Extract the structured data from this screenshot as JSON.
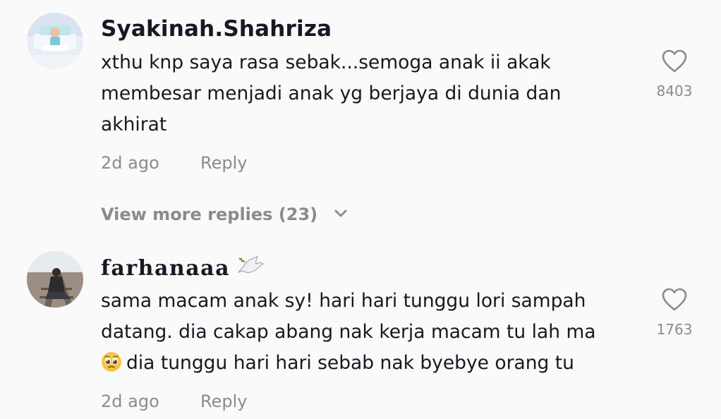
{
  "comments": [
    {
      "username": "Syakinah.Shahriza",
      "text_lines": [
        "xthu knp saya rasa sebak...semoga anak ii akak",
        "membesar menjadi anak yg berjaya di dunia dan",
        "akhirat"
      ],
      "time": "2d ago",
      "reply_label": "Reply",
      "likes": "8403",
      "view_more": "View more replies (23)"
    },
    {
      "username": "farhanaaa",
      "text_lines": [
        "sama macam anak sy! hari hari tunggu lori sampah",
        "datang. dia cakap abang nak kerja macam tu lah ma",
        "dia tunggu hari hari sebab nak byebye orang tu"
      ],
      "emoji": "pleading-face-emoji",
      "time": "2d ago",
      "reply_label": "Reply",
      "likes": "1763"
    }
  ],
  "icons": {
    "like": "heart-outline-icon",
    "expand": "chevron-down-icon",
    "username_decoration": "dove-icon"
  },
  "colors": {
    "background": "#fafafa",
    "text": "#161823",
    "secondary": "#8a8b91"
  }
}
